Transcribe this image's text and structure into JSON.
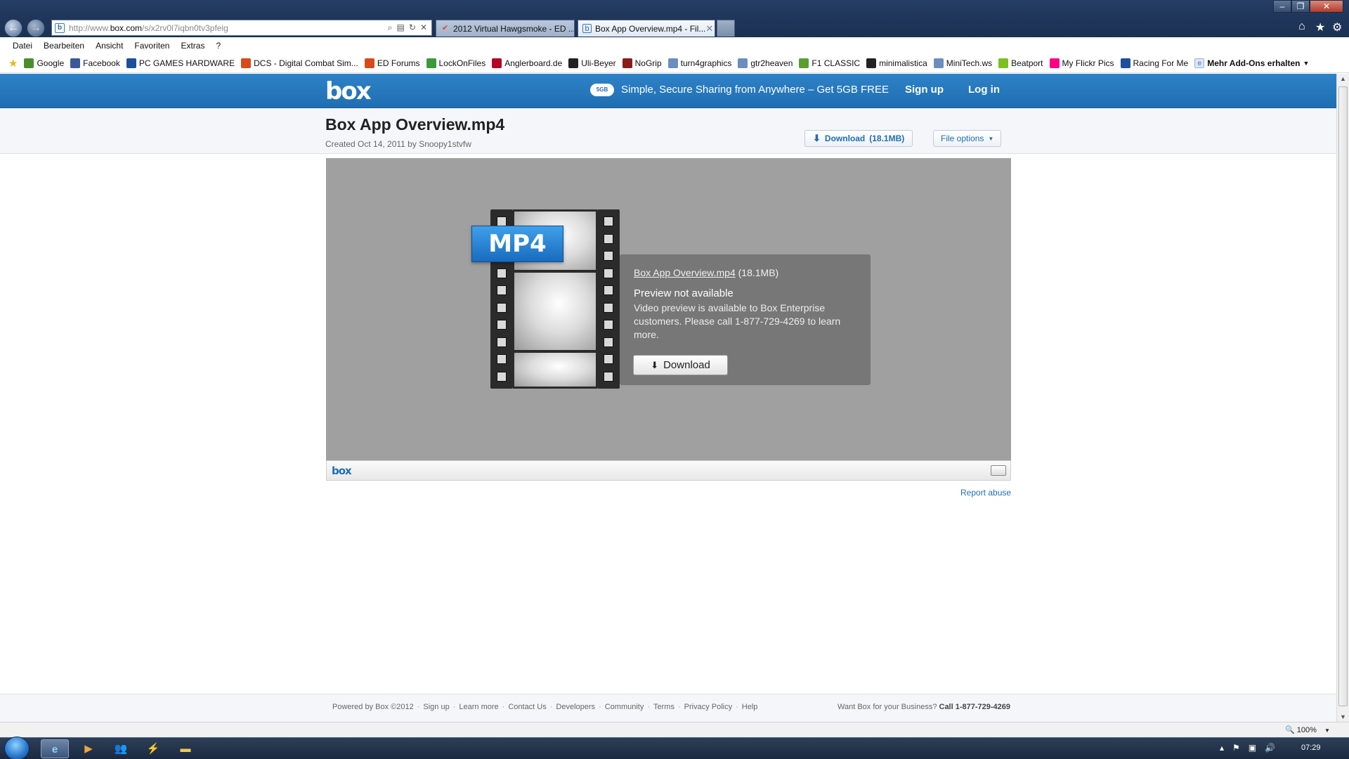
{
  "browser": {
    "url_prefix": "http://www.",
    "url_domain": "box.com",
    "url_path": "/s/x2rv0l7iqbn0tv3pfeig",
    "tabs": [
      {
        "label": "2012 Virtual Hawgsmoke - ED ..."
      },
      {
        "label": "Box App Overview.mp4 - Fil..."
      }
    ],
    "menu": [
      "Datei",
      "Bearbeiten",
      "Ansicht",
      "Favoriten",
      "Extras",
      "?"
    ],
    "favorites": [
      {
        "label": "Google",
        "color": "#4a8f2e"
      },
      {
        "label": "Facebook",
        "color": "#3b5998"
      },
      {
        "label": "PC GAMES HARDWARE",
        "color": "#1d4f9c"
      },
      {
        "label": "DCS - Digital Combat Sim...",
        "color": "#d84a1b"
      },
      {
        "label": "ED Forums",
        "color": "#d84a1b"
      },
      {
        "label": "LockOnFiles",
        "color": "#3a9b3a"
      },
      {
        "label": "Anglerboard.de",
        "color": "#b5002a"
      },
      {
        "label": "Uli-Beyer",
        "color": "#222222"
      },
      {
        "label": "NoGrip",
        "color": "#8a1c1c"
      },
      {
        "label": "turn4graphics",
        "color": "#6a8fbf"
      },
      {
        "label": "gtr2heaven",
        "color": "#6a8fbf"
      },
      {
        "label": "F1 CLASSIC",
        "color": "#5a9e2f"
      },
      {
        "label": "minimalistica",
        "color": "#222222"
      },
      {
        "label": "MiniTech.ws",
        "color": "#6a8fbf"
      },
      {
        "label": "Beatport",
        "color": "#7cbf1f"
      },
      {
        "label": "My Flickr Pics",
        "color": "#ff0084"
      },
      {
        "label": "Racing For Me",
        "color": "#1d4f9c"
      }
    ],
    "addons_label": "Mehr Add-Ons erhalten",
    "zoom": "100%",
    "clock": "07:29"
  },
  "header": {
    "logo": "box",
    "cloud_badge": "5GB",
    "promo": "Simple, Secure Sharing from Anywhere – Get 5GB FREE",
    "signup": "Sign up",
    "login": "Log in"
  },
  "file": {
    "title": "Box App Overview.mp4",
    "meta": "Created Oct 14, 2011 by Snoopy1stvfw",
    "download_label": "Download",
    "download_size": "(18.1MB)",
    "options_label": "File options"
  },
  "preview": {
    "badge": "MP4",
    "file_link": "Box App Overview.mp4",
    "file_size": "(18.1MB)",
    "heading": "Preview not available",
    "body": "Video preview is available to Box Enterprise customers. Please call 1-877-729-4269 to learn more.",
    "download_button": "Download",
    "footer_logo": "box"
  },
  "report_abuse": "Report abuse",
  "footer": {
    "copyright": "Powered by Box ©2012",
    "links": [
      "Sign up",
      "Learn more",
      "Contact Us",
      "Developers",
      "Community",
      "Terms",
      "Privacy Policy",
      "Help"
    ],
    "business_text": "Want Box for your Business?",
    "business_phone": "Call 1-877-729-4269"
  }
}
